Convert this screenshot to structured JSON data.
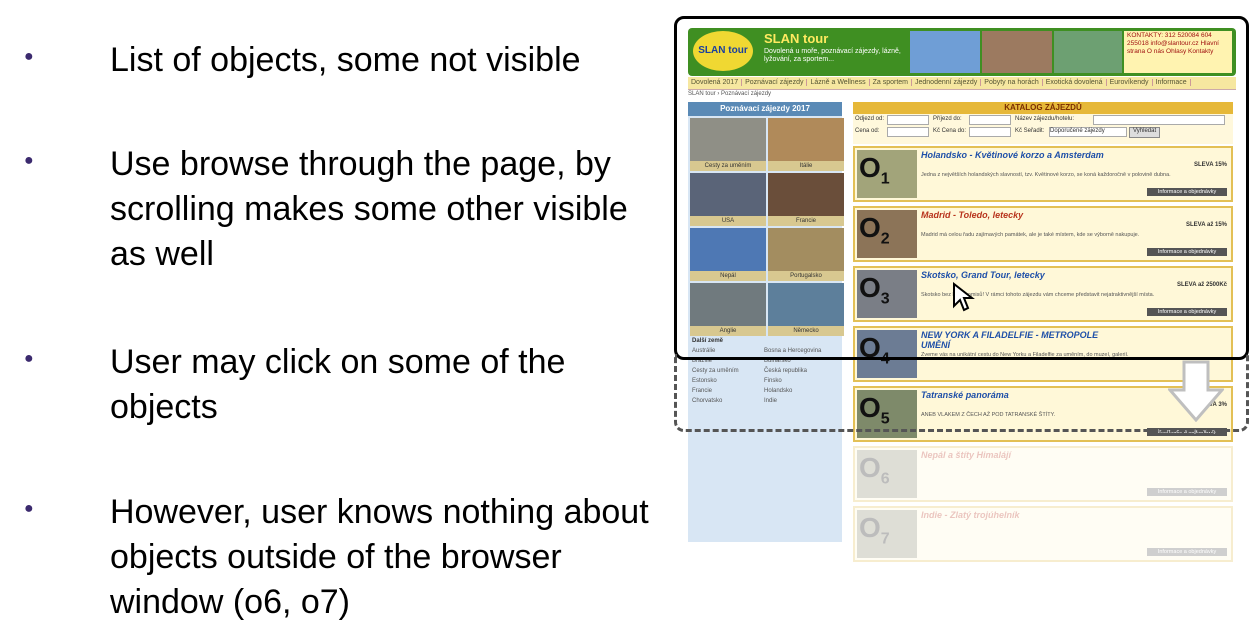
{
  "bullets": [
    "List of objects, some not visible",
    "Use browse through the page, by scrolling makes some other visible as well",
    "User may click on some of the objects",
    "However, user knows nothing about objects outside of the browser window (o6, o7)"
  ],
  "site": {
    "brand": "SLAN tour",
    "logo_text": "SLAN tour",
    "tagline": "Dovolená u moře, poznávací zájezdy, lázně, lyžování, za sportem...",
    "contacts": "KONTAKTY:  312 520084  604 255018  info@slantour.cz  Hlavní strana  O nás  Ohlasy  Kontakty",
    "nav": [
      "Dovolená 2017",
      "Poznávací zájezdy",
      "Lázně a Wellness",
      "Za sportem",
      "Jednodenní zájezdy",
      "Pobyty na horách",
      "Exotická dovolená",
      "Eurovíkendy",
      "Informace"
    ],
    "breadcrumb": "SLAN tour › Poznávací zájezdy",
    "left_title": "Poznávací zájezdy 2017",
    "tiles": [
      "Cesty za uměním",
      "Itálie",
      "USA",
      "Francie",
      "Nepál",
      "Portugalsko",
      "Anglie",
      "Německo"
    ],
    "other_countries_label": "Další země",
    "countries": [
      "Austrálie",
      "Bosna a Hercegovina",
      "Brazílie",
      "Bulharsko",
      "Cesty za uměním",
      "Česká republika",
      "Estonsko",
      "Finsko",
      "Francie",
      "Holandsko",
      "Chorvatsko",
      "Indie"
    ],
    "catalog_title": "KATALOG ZÁJEZDŮ",
    "filters": {
      "from": "Odjezd od:",
      "arrival": "Příjezd do:",
      "name": "Název zájezdu/hotelu:",
      "price_from": "Cena od:",
      "price_to": "Kč Cena do:",
      "sort": "Kč Seřadit:",
      "sort_value": "Doporučené zájezdy",
      "search": "Vyhledat"
    }
  },
  "items": [
    {
      "label": "O",
      "sub": "1",
      "title": "Holandsko - Květinové korzo a Amsterdam",
      "desc": "Jedna z největších holandských slavností, tzv. Květinové korzo, se koná každoročně v polovině dubna.",
      "sleva": "SLEVA 15%",
      "button": "Informace a objednávky"
    },
    {
      "label": "O",
      "sub": "2",
      "title": "Madrid - Toledo, letecky",
      "desc": "Madrid má celou řadu zajímavých památek, ale je také místem, kde se výborně nakupuje.",
      "sleva": "SLEVA až 15%",
      "button": "Informace a objednávky"
    },
    {
      "label": "O",
      "sub": "3",
      "title": "Skotsko, Grand Tour, letecky",
      "desc": "Skotsko bez kompromisů! V rámci tohoto zájezdu vám chceme představit nejatraktivnější místa.",
      "sleva": "SLEVA až 2500Kč",
      "button": "Informace a objednávky"
    },
    {
      "label": "O",
      "sub": "4",
      "title": "NEW YORK A FILADELFIE - METROPOLE UMĚNÍ",
      "desc": "Zveme vás na unikátní cestu do New Yorku a Filadelfie za uměním, do muzeí, galerií.",
      "sleva": "",
      "button": ""
    },
    {
      "label": "O",
      "sub": "5",
      "title": "Tatranské panoráma",
      "desc": "ANEB VLAKEM Z ČECH AŽ POD TATRANSKÉ ŠTÍTY.",
      "sleva": "SLEVA 3%",
      "button": "Informace a objednávky"
    },
    {
      "label": "O",
      "sub": "6",
      "title": "Nepál a štíty Himalájí",
      "desc": "",
      "sleva": "",
      "button": "Informace a objednávky"
    },
    {
      "label": "O",
      "sub": "7",
      "title": "Indie - Zlatý trojúhelník",
      "desc": "",
      "sleva": "",
      "button": "Informace a objednávky"
    }
  ]
}
